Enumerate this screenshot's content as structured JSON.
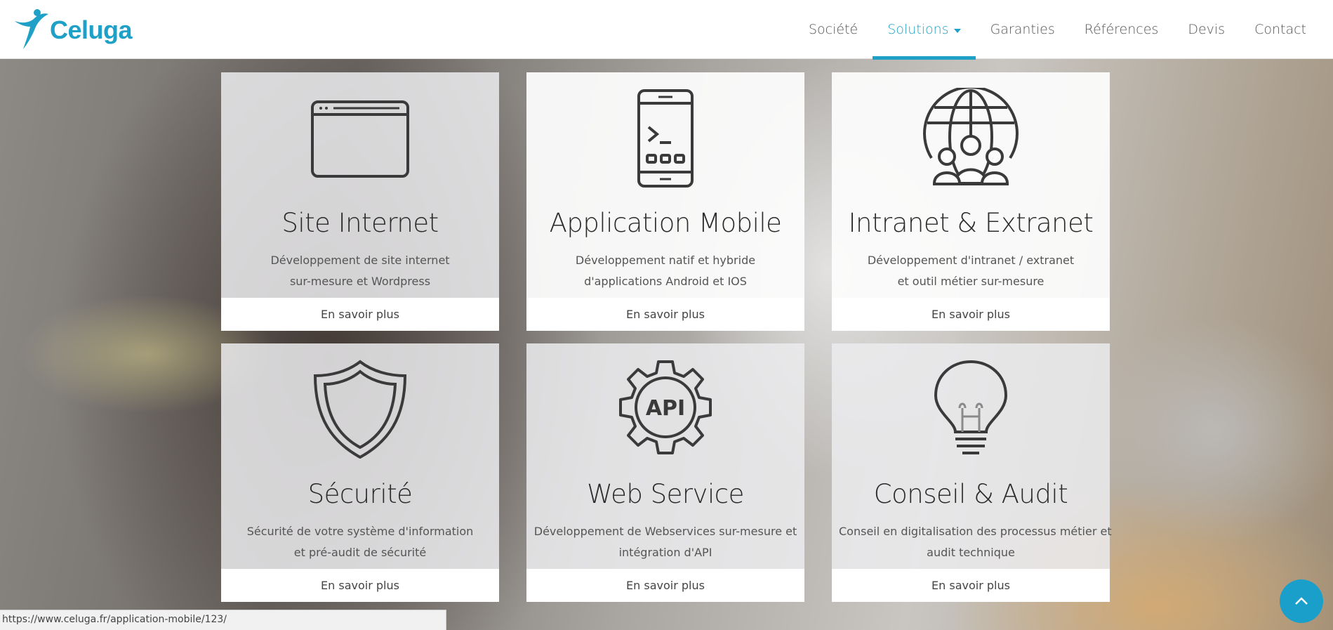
{
  "brand": {
    "name": "Celuga",
    "accent": "#1fa0c6"
  },
  "nav": {
    "items": [
      {
        "label": "Société",
        "active": false
      },
      {
        "label": "Solutions",
        "active": true,
        "dropdown": true
      },
      {
        "label": "Garanties",
        "active": false
      },
      {
        "label": "Références",
        "active": false
      },
      {
        "label": "Devis",
        "active": false
      },
      {
        "label": "Contact",
        "active": false
      }
    ]
  },
  "cards": [
    {
      "icon": "browser-window-icon",
      "title": "Site Internet",
      "desc_line1": "Développement de site internet",
      "desc_line2": "sur-mesure et Wordpress",
      "button": "En savoir plus"
    },
    {
      "icon": "smartphone-terminal-icon",
      "title": "Application Mobile",
      "desc_line1": "Développement natif et hybride",
      "desc_line2": "d'applications Android et IOS",
      "button": "En savoir plus"
    },
    {
      "icon": "globe-team-icon",
      "title": "Intranet & Extranet",
      "desc_line1": "Développement d'intranet / extranet",
      "desc_line2": "et outil métier sur-mesure",
      "button": "En savoir plus"
    },
    {
      "icon": "shield-icon",
      "title": "Sécurité",
      "desc_line1": "Sécurité de votre système d'information",
      "desc_line2": "et pré-audit de sécurité",
      "button": "En savoir plus"
    },
    {
      "icon": "api-gear-icon",
      "title": "Web Service",
      "desc_line1": "Développement de Webservices sur-mesure et",
      "desc_line2": "intégration d'API",
      "button": "En savoir plus"
    },
    {
      "icon": "lightbulb-icon",
      "title": "Conseil & Audit",
      "desc_line1": "Conseil en digitalisation des processus métier et",
      "desc_line2": "audit technique",
      "button": "En savoir plus"
    }
  ],
  "api_icon_text": "API",
  "status_bar": {
    "url": "https://www.celuga.fr/application-mobile/123/"
  },
  "back_to_top": {
    "icon": "chevron-up-icon"
  }
}
